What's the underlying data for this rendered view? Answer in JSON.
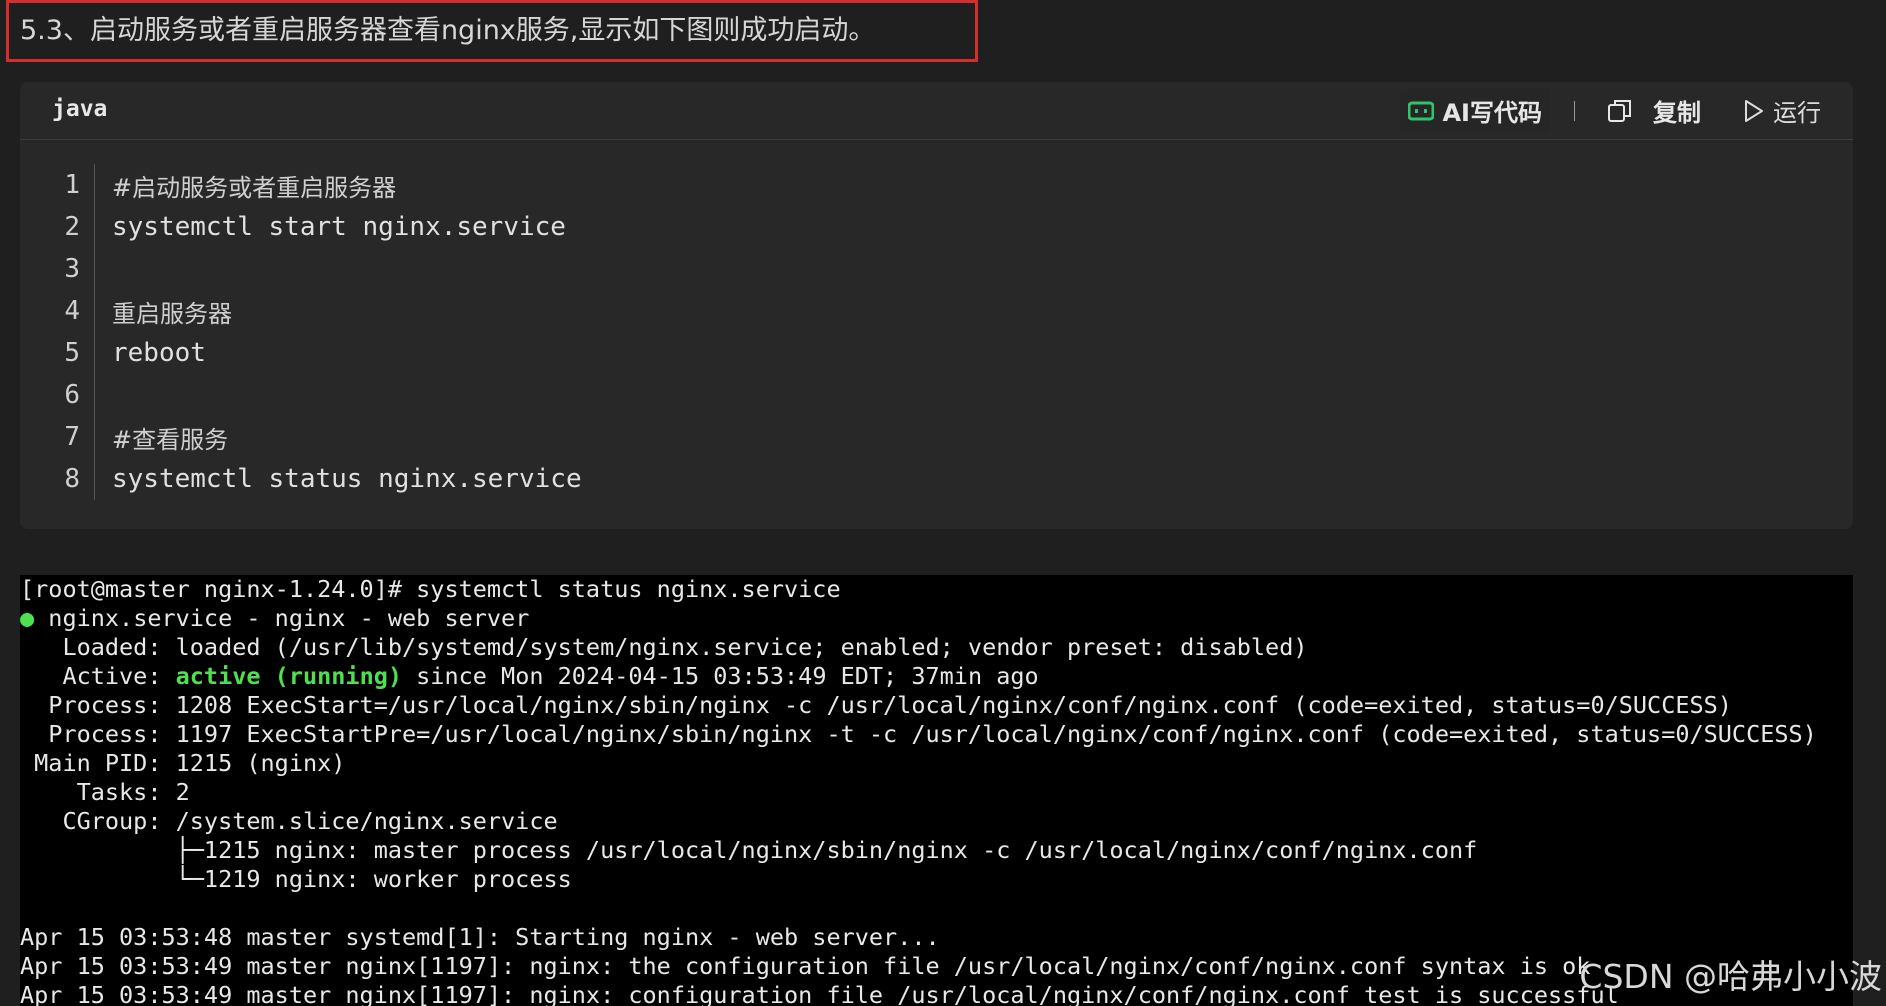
{
  "heading": {
    "text": "5.3、启动服务或者重启服务器查看nginx服务,显示如下图则成功启动。"
  },
  "code_block": {
    "language": "java",
    "toolbar": {
      "ai_label": "AI写代码",
      "copy_label": "复制",
      "run_label": "运行"
    },
    "lines": [
      {
        "num": "1",
        "text": "#启动服务或者重启服务器"
      },
      {
        "num": "2",
        "text": "systemctl start nginx.service"
      },
      {
        "num": "3",
        "text": ""
      },
      {
        "num": "4",
        "text": "重启服务器"
      },
      {
        "num": "5",
        "text": "reboot"
      },
      {
        "num": "6",
        "text": ""
      },
      {
        "num": "7",
        "text": "#查看服务"
      },
      {
        "num": "8",
        "text": "systemctl status nginx.service"
      }
    ]
  },
  "terminal": {
    "prompt_line": "[root@master nginx-1.24.0]# systemctl status nginx.service",
    "service_line": " nginx.service - nginx - web server",
    "status_dot": "●",
    "loaded_line": "   Loaded: loaded (/usr/lib/systemd/system/nginx.service; enabled; vendor preset: disabled)",
    "active_prefix": "   Active: ",
    "active_status": "active (running)",
    "active_suffix": " since Mon 2024-04-15 03:53:49 EDT; 37min ago",
    "process1_line": "  Process: 1208 ExecStart=/usr/local/nginx/sbin/nginx -c /usr/local/nginx/conf/nginx.conf (code=exited, status=0/SUCCESS)",
    "process2_line": "  Process: 1197 ExecStartPre=/usr/local/nginx/sbin/nginx -t -c /usr/local/nginx/conf/nginx.conf (code=exited, status=0/SUCCESS)",
    "mainpid_line": " Main PID: 1215 (nginx)",
    "tasks_line": "    Tasks: 2",
    "cgroup_line": "   CGroup: /system.slice/nginx.service",
    "cgroup_child1": "           ├─1215 nginx: master process /usr/local/nginx/sbin/nginx -c /usr/local/nginx/conf/nginx.conf",
    "cgroup_child2": "           └─1219 nginx: worker process",
    "log1": "Apr 15 03:53:48 master systemd[1]: Starting nginx - web server...",
    "log2": "Apr 15 03:53:49 master nginx[1197]: nginx: the configuration file /usr/local/nginx/conf/nginx.conf syntax is ok",
    "log3": "Apr 15 03:53:49 master nginx[1197]: nginx: configuration file /usr/local/nginx/conf/nginx.conf test is successful"
  },
  "watermark": "CSDN @哈弗小小波",
  "colors": {
    "highlight_border": "#d32f2f",
    "active_green": "#4ee04e",
    "ai_icon_green": "#2fc46b"
  }
}
